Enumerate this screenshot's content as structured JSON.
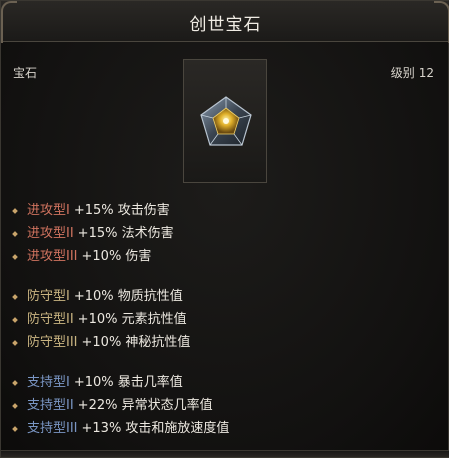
{
  "title": "创世宝石",
  "category": "宝石",
  "level": {
    "label": "级别",
    "value": "12"
  },
  "icon": "gem-icon",
  "colors": {
    "attack": "#d0735f",
    "defense": "#c9b481",
    "support": "#7a96c4"
  },
  "groups": [
    {
      "kind": "attack",
      "affixes": [
        {
          "tier": "进攻型I",
          "desc": "+15% 攻击伤害"
        },
        {
          "tier": "进攻型II",
          "desc": "+15% 法术伤害"
        },
        {
          "tier": "进攻型III",
          "desc": "+10% 伤害"
        }
      ]
    },
    {
      "kind": "defense",
      "affixes": [
        {
          "tier": "防守型I",
          "desc": "+10% 物质抗性值"
        },
        {
          "tier": "防守型II",
          "desc": "+10% 元素抗性值"
        },
        {
          "tier": "防守型III",
          "desc": "+10% 神秘抗性值"
        }
      ]
    },
    {
      "kind": "support",
      "affixes": [
        {
          "tier": "支持型I",
          "desc": "+10% 暴击几率值"
        },
        {
          "tier": "支持型II",
          "desc": "+22% 异常状态几率值"
        },
        {
          "tier": "支持型III",
          "desc": "+13% 攻击和施放速度值"
        }
      ]
    }
  ]
}
